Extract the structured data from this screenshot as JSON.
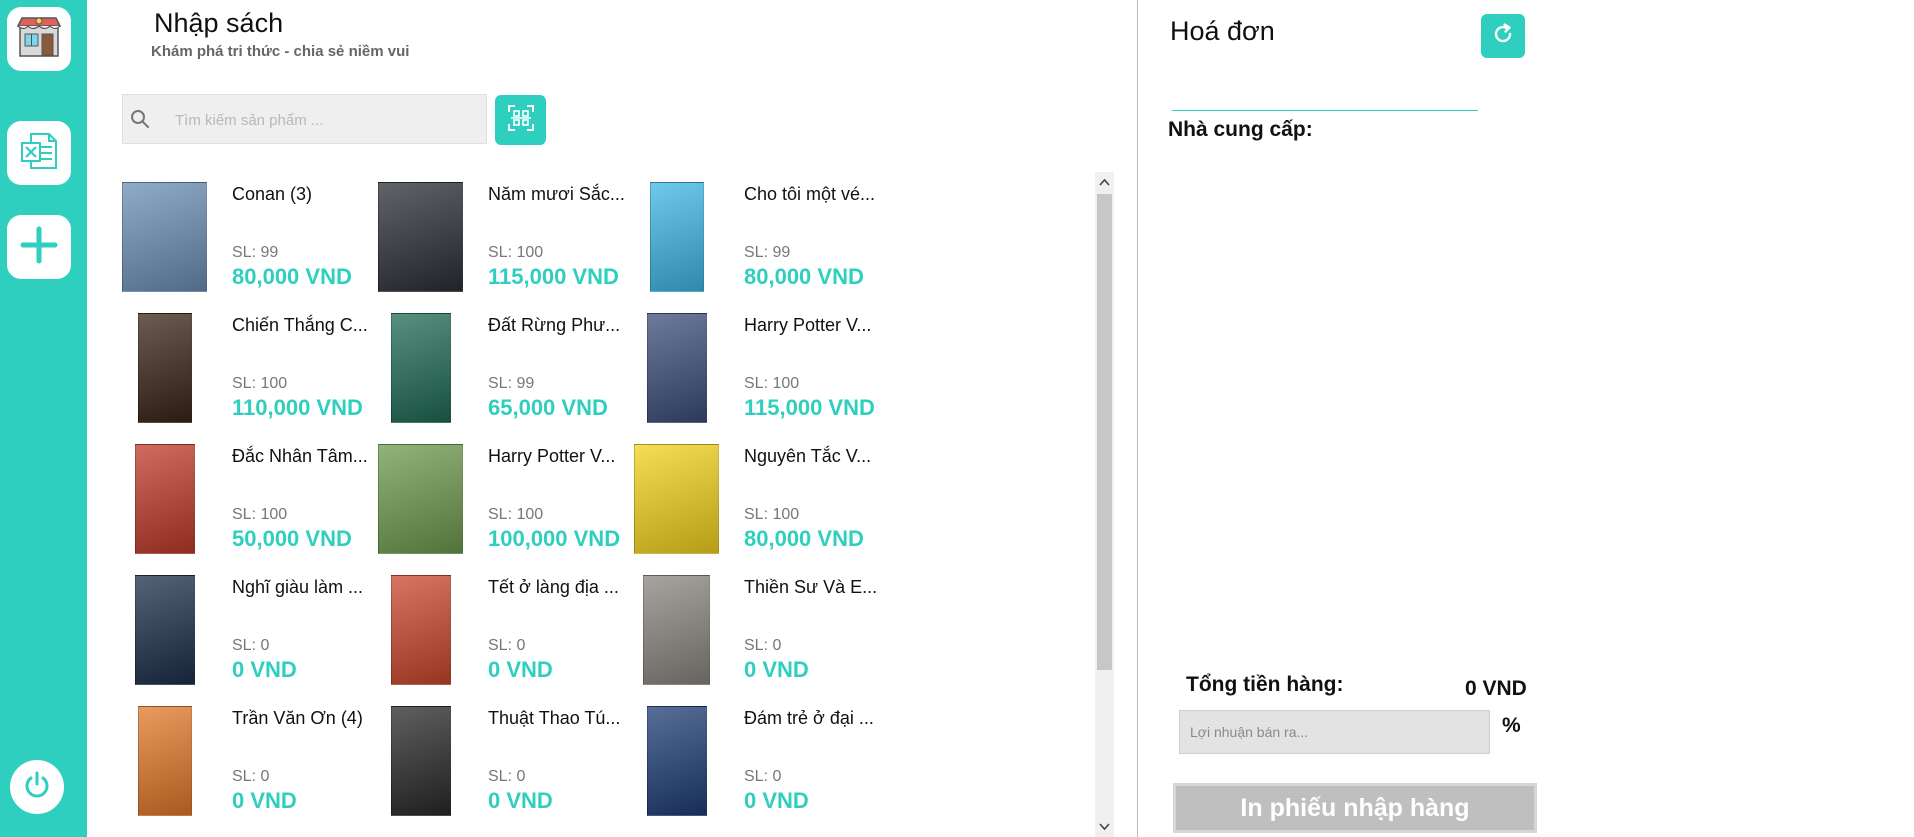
{
  "theme": {
    "accent": "#2ecfbf",
    "price_color": "#2ecfbf",
    "disabled_button": "#bfbfbf"
  },
  "sidebar": {
    "items": [
      {
        "icon": "store-icon"
      },
      {
        "icon": "excel-icon"
      },
      {
        "icon": "plus-icon"
      }
    ],
    "footer_icon": "power-icon"
  },
  "header": {
    "title": "Nhập sách",
    "subtitle": "Khám phá tri thức - chia sẻ niềm vui"
  },
  "search": {
    "placeholder": "Tìm kiếm sản phẩm ...",
    "value": "",
    "scan_icon": "barcode-scan-icon"
  },
  "products": [
    {
      "name": "Conan (3)",
      "qty": "SL: 99",
      "price": "80,000 VND",
      "cover": "#6b8fb5"
    },
    {
      "name": "Năm mươi Sắc...",
      "qty": "SL: 100",
      "price": "115,000 VND",
      "cover": "#2b2f36"
    },
    {
      "name": "Cho tôi một vé...",
      "qty": "SL: 99",
      "price": "80,000 VND",
      "cover": "#3fb7e6"
    },
    {
      "name": "Chiến Thắng C...",
      "qty": "SL: 100",
      "price": "110,000 VND",
      "cover": "#3a2418"
    },
    {
      "name": "Đất Rừng Phư...",
      "qty": "SL: 99",
      "price": "65,000 VND",
      "cover": "#1f6b55"
    },
    {
      "name": "Harry Potter V...",
      "qty": "SL: 100",
      "price": "115,000 VND",
      "cover": "#3b4e7a"
    },
    {
      "name": "Đắc Nhân Tâm...",
      "qty": "SL: 100",
      "price": "50,000 VND",
      "cover": "#c0392b"
    },
    {
      "name": "Harry Potter V...",
      "qty": "SL: 100",
      "price": "100,000 VND",
      "cover": "#6e9a4f"
    },
    {
      "name": "Nguyên Tắc V...",
      "qty": "SL: 100",
      "price": "80,000 VND",
      "cover": "#f2d21f"
    },
    {
      "name": "Nghĩ giàu làm ...",
      "qty": "SL: 0",
      "price": "0 VND",
      "cover": "#1d2f4a"
    },
    {
      "name": "Tết ở làng địa ...",
      "qty": "SL: 0",
      "price": "0 VND",
      "cover": "#c8472e"
    },
    {
      "name": "Thiền Sư Và E...",
      "qty": "SL: 0",
      "price": "0 VND",
      "cover": "#8a8580"
    },
    {
      "name": "Trần Văn Ơn (4)",
      "qty": "SL: 0",
      "price": "0 VND",
      "cover": "#e0782a"
    },
    {
      "name": "Thuật Thao Tú...",
      "qty": "SL: 0",
      "price": "0 VND",
      "cover": "#2a2a2a"
    },
    {
      "name": "Đám trẻ ở đại ...",
      "qty": "SL: 0",
      "price": "0 VND",
      "cover": "#1f3e73"
    }
  ],
  "invoice": {
    "title": "Hoá đơn",
    "refresh_icon": "refresh-icon",
    "supplier_label": "Nhà cung cấp:",
    "total_label": "Tổng tiền hàng:",
    "total_value": "0 VND",
    "profit_placeholder": "Lợi nhuận bán ra...",
    "profit_value": "",
    "percent_sign": "%",
    "print_button": "In phiếu nhập hàng"
  }
}
